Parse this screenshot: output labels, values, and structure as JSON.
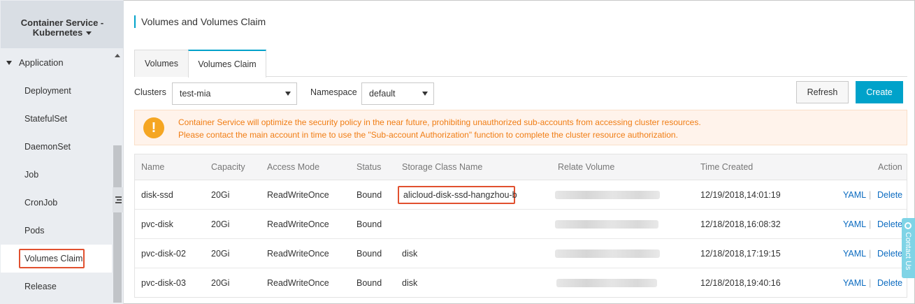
{
  "sidebar": {
    "header_line1": "Container Service -",
    "header_line2": "Kubernetes",
    "group_label": "Application",
    "items": [
      {
        "label": "Deployment"
      },
      {
        "label": "StatefulSet"
      },
      {
        "label": "DaemonSet"
      },
      {
        "label": "Job"
      },
      {
        "label": "CronJob"
      },
      {
        "label": "Pods"
      },
      {
        "label": "Volumes Claim"
      },
      {
        "label": "Release"
      }
    ],
    "active_item": "Volumes Claim"
  },
  "page": {
    "title": "Volumes and Volumes Claim"
  },
  "tabs": [
    {
      "label": "Volumes"
    },
    {
      "label": "Volumes Claim"
    }
  ],
  "active_tab": "Volumes Claim",
  "filters": {
    "clusters_label": "Clusters",
    "clusters_value": "test-mia",
    "namespace_label": "Namespace",
    "namespace_value": "default"
  },
  "toolbar": {
    "refresh_label": "Refresh",
    "create_label": "Create"
  },
  "notice": {
    "icon": "!",
    "line1": "Container Service will optimize the security policy in the near future, prohibiting unauthorized sub-accounts from accessing cluster resources.",
    "line2": "Please contact the main account in time to use the \"Sub-account Authorization\" function to complete the cluster resource authorization."
  },
  "table": {
    "columns": [
      "Name",
      "Capacity",
      "Access Mode",
      "Status",
      "Storage Class Name",
      "Relate Volume",
      "Time Created",
      "Action"
    ],
    "rows": [
      {
        "name": "disk-ssd",
        "capacity": "20Gi",
        "access_mode": "ReadWriteOnce",
        "status": "Bound",
        "storage_class": "alicloud-disk-ssd-hangzhou-b",
        "time_created": "12/19/2018,14:01:19",
        "yaml": "YAML",
        "sep": "|",
        "delete": "Delete"
      },
      {
        "name": "pvc-disk",
        "capacity": "20Gi",
        "access_mode": "ReadWriteOnce",
        "status": "Bound",
        "storage_class": "",
        "time_created": "12/18/2018,16:08:32",
        "yaml": "YAML",
        "sep": "|",
        "delete": "Delete"
      },
      {
        "name": "pvc-disk-02",
        "capacity": "20Gi",
        "access_mode": "ReadWriteOnce",
        "status": "Bound",
        "storage_class": "disk",
        "time_created": "12/18/2018,17:19:15",
        "yaml": "YAML",
        "sep": "|",
        "delete": "Delete"
      },
      {
        "name": "pvc-disk-03",
        "capacity": "20Gi",
        "access_mode": "ReadWriteOnce",
        "status": "Bound",
        "storage_class": "disk",
        "time_created": "12/18/2018,19:40:16",
        "yaml": "YAML",
        "sep": "|",
        "delete": "Delete"
      }
    ]
  },
  "contact": {
    "label": "Contact Us"
  },
  "colors": {
    "accent": "#00a2ca",
    "link": "#0b6bc0",
    "warning_text": "#f07d14",
    "warning_icon": "#f5a623",
    "highlight_box": "#e1502f"
  }
}
